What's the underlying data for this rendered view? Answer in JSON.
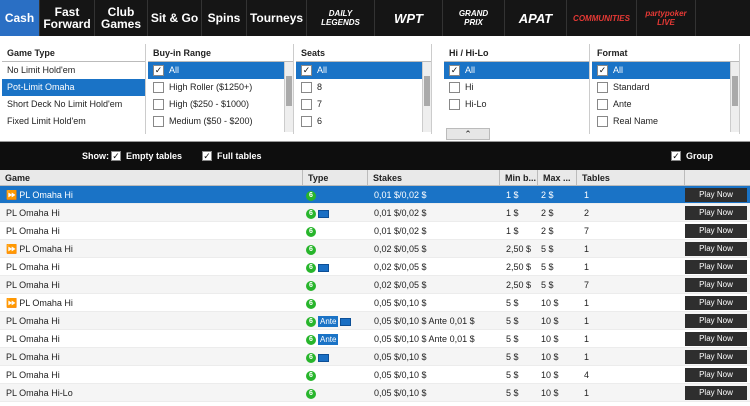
{
  "nav": {
    "tabs": [
      {
        "label": "Cash",
        "active": true
      },
      {
        "label": "Fast\nForward"
      },
      {
        "label": "Club\nGames"
      },
      {
        "label": "Sit & Go"
      },
      {
        "label": "Spins"
      },
      {
        "label": "Tourneys"
      }
    ],
    "promos": [
      {
        "label": "DAILY\nLEGENDS",
        "color": "#ffffff"
      },
      {
        "label": "WPT",
        "color": "#ffffff"
      },
      {
        "label": "GRAND\nPRIX",
        "color": "#ffffff"
      },
      {
        "label": "APAT",
        "color": "#ffffff"
      },
      {
        "label": "COMMUNITIES",
        "color": "#e53935"
      },
      {
        "label": "partypoker\nLIVE",
        "color": "#e53935"
      }
    ]
  },
  "filters": {
    "game_type": {
      "title": "Game Type",
      "items": [
        "No Limit Hold'em",
        "Pot-Limit Omaha",
        "Short Deck No Limit Hold'em",
        "Fixed Limit Hold'em"
      ],
      "selected": 1
    },
    "buyin": {
      "title": "Buy-in Range",
      "items": [
        "All",
        "High Roller ($1250+)",
        "High ($250 - $1000)",
        "Medium ($50 - $200)"
      ],
      "checked": [
        true,
        false,
        false,
        false
      ]
    },
    "seats": {
      "title": "Seats",
      "items": [
        "All",
        "8",
        "7",
        "6"
      ],
      "checked": [
        true,
        false,
        false,
        false
      ]
    },
    "hilo": {
      "title": "Hi / Hi-Lo",
      "items": [
        "All",
        "Hi",
        "Hi-Lo"
      ],
      "checked": [
        true,
        false,
        false
      ]
    },
    "format": {
      "title": "Format",
      "items": [
        "All",
        "Standard",
        "Ante",
        "Real Name"
      ],
      "checked": [
        true,
        false,
        false,
        false
      ]
    }
  },
  "show": {
    "label": "Show:",
    "empty": "Empty tables",
    "full": "Full tables",
    "group": "Group"
  },
  "table": {
    "headers": [
      "Game",
      "Type",
      "Stakes",
      "Min b...",
      "Max ...",
      "Tables"
    ],
    "play_label": "Play Now",
    "rows": [
      {
        "ff": true,
        "game": "PL Omaha Hi",
        "card": false,
        "ante": false,
        "stakes": "0,01 $/0,02 $",
        "min": "1 $",
        "max": "2 $",
        "tables": "1",
        "sel": true
      },
      {
        "ff": false,
        "game": "PL Omaha Hi",
        "card": true,
        "ante": false,
        "stakes": "0,01 $/0,02 $",
        "min": "1 $",
        "max": "2 $",
        "tables": "2"
      },
      {
        "ff": false,
        "game": "PL Omaha Hi",
        "card": false,
        "ante": false,
        "stakes": "0,01 $/0,02 $",
        "min": "1 $",
        "max": "2 $",
        "tables": "7"
      },
      {
        "ff": true,
        "game": "PL Omaha Hi",
        "card": false,
        "ante": false,
        "stakes": "0,02 $/0,05 $",
        "min": "2,50 $",
        "max": "5 $",
        "tables": "1"
      },
      {
        "ff": false,
        "game": "PL Omaha Hi",
        "card": true,
        "ante": false,
        "stakes": "0,02 $/0,05 $",
        "min": "2,50 $",
        "max": "5 $",
        "tables": "1"
      },
      {
        "ff": false,
        "game": "PL Omaha Hi",
        "card": false,
        "ante": false,
        "stakes": "0,02 $/0,05 $",
        "min": "2,50 $",
        "max": "5 $",
        "tables": "7"
      },
      {
        "ff": true,
        "game": "PL Omaha Hi",
        "card": false,
        "ante": false,
        "stakes": "0,05 $/0,10 $",
        "min": "5 $",
        "max": "10 $",
        "tables": "1"
      },
      {
        "ff": false,
        "game": "PL Omaha Hi",
        "card": true,
        "ante": true,
        "stakes": "0,05 $/0,10 $ Ante 0,01 $",
        "min": "5 $",
        "max": "10 $",
        "tables": "1"
      },
      {
        "ff": false,
        "game": "PL Omaha Hi",
        "card": false,
        "ante": true,
        "stakes": "0,05 $/0,10 $ Ante 0,01 $",
        "min": "5 $",
        "max": "10 $",
        "tables": "1"
      },
      {
        "ff": false,
        "game": "PL Omaha Hi",
        "card": true,
        "ante": false,
        "stakes": "0,05 $/0,10 $",
        "min": "5 $",
        "max": "10 $",
        "tables": "1"
      },
      {
        "ff": false,
        "game": "PL Omaha Hi",
        "card": false,
        "ante": false,
        "stakes": "0,05 $/0,10 $",
        "min": "5 $",
        "max": "10 $",
        "tables": "4"
      },
      {
        "ff": false,
        "game": "PL Omaha Hi-Lo",
        "card": false,
        "ante": false,
        "stakes": "0,05 $/0,10 $",
        "min": "5 $",
        "max": "10 $",
        "tables": "1"
      }
    ],
    "type_badge": "6",
    "ante_label": "Ante"
  },
  "colors": {
    "accent": "#1a73c6",
    "nav_bg": "#151515",
    "badge": "#27b52b"
  }
}
